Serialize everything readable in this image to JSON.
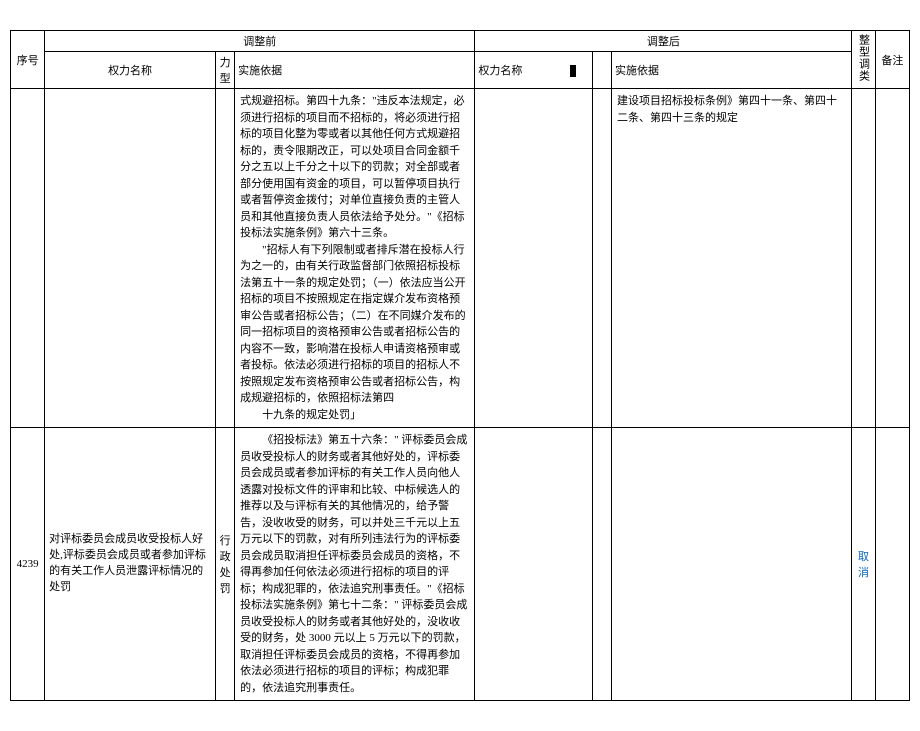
{
  "header": {
    "seq": "序号",
    "before_group": "调整前",
    "after_group": "调整后",
    "name": "权力名称",
    "type": "力型",
    "basis": "实施依据",
    "adjust": "整型调类",
    "note": "备注"
  },
  "row_top": {
    "basis_before": "式规避招标。第四十九条：\"违反本法规定，必须进行招标的项目而不招标的，将必须进行招标的项目化整为零或者以其他任何方式规避招标的，责令限期改正，可以处项目合同金额千分之五以上千分之十以下的罚款；对全部或者部分使用国有资金的项目，可以暂停项目执行或者暂停资金拨付；对单位直接负责的主管人员和其他直接负责人员依法给予处分。\"《招标投标法实施条例》第六十三条。",
    "basis_before_p2": "\"招标人有下列限制或者排斥潜在投标人行为之一的，由有关行政监督部门依照招标投标法第五十一条的规定处罚；（一）依法应当公开招标的项目不按照规定在指定媒介发布资格预审公告或者招标公告；（二）在不同媒介发布的同一招标项目的资格预审公告或者招标公告的内容不一致，影响潜在投标人申请资格预审或者投标。依法必须进行招标的项目的招标人不按照规定发布资格预审公告或者招标公告，构成规避招标的，依照招标法第四",
    "basis_before_p3": "十九条的规定处罚」",
    "basis_after": "建设项目招标投标条例》第四十一条、第四十二条、第四十三条的规定"
  },
  "row_4239": {
    "seq": "4239",
    "name_before": "对评标委员会成员收受投标人好处,评标委员会成员或者参加评标的有关工作人员泄露评标情况的处罚",
    "type_before": "行政处罚",
    "basis_before_p1": "《招投标法》第五十六条：\" 评标委员会成员收受投标人的财务或者其他好处的，评标委员会成员或者参加评标的有关工作人员向他人透露对投标文件的评审和比较、中标候选人的推荐以及与评标有关的其他情况的，给予警告，没收收受的财务，可以并处三千元以上五万元以下的罚款，对有所列违法行为的评标委员会成员取消担任评标委员会成员的资格，不得再参加任何依法必须进行招标的项目的评标；构成犯罪的，依法追究刑事责任。\"《招标投标法实施条例》第七十二条：\" 评标委员会成员收受投标人的财务或者其他好处的，没收收受的财务，处 3000 元以上 5 万元以下的罚款，取消担任评标委员会成员的资格，不得再参加依法必须进行招标的项目的评标；构成犯罪的，依法追究刑事责任。",
    "adjust_link": "取消"
  }
}
